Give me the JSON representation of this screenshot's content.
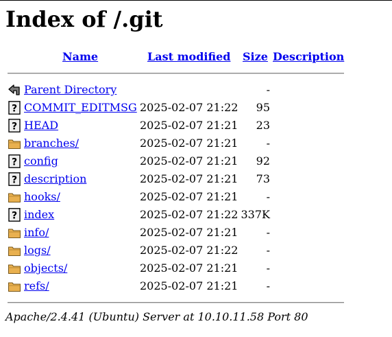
{
  "page": {
    "title": "Index of /.git"
  },
  "table": {
    "headers": {
      "name": "Name",
      "last_modified": "Last modified",
      "size": "Size",
      "description": "Description"
    },
    "rows": [
      {
        "icon": "back-icon",
        "name": "Parent Directory",
        "modified": "",
        "size": "-"
      },
      {
        "icon": "unknown-file-icon",
        "name": "COMMIT_EDITMSG",
        "modified": "2025-02-07 21:22",
        "size": "95"
      },
      {
        "icon": "unknown-file-icon",
        "name": "HEAD",
        "modified": "2025-02-07 21:21",
        "size": "23"
      },
      {
        "icon": "folder-icon",
        "name": "branches/",
        "modified": "2025-02-07 21:21",
        "size": "-"
      },
      {
        "icon": "unknown-file-icon",
        "name": "config",
        "modified": "2025-02-07 21:21",
        "size": "92"
      },
      {
        "icon": "unknown-file-icon",
        "name": "description",
        "modified": "2025-02-07 21:21",
        "size": "73"
      },
      {
        "icon": "folder-icon",
        "name": "hooks/",
        "modified": "2025-02-07 21:21",
        "size": "-"
      },
      {
        "icon": "unknown-file-icon",
        "name": "index",
        "modified": "2025-02-07 21:22",
        "size": "337K"
      },
      {
        "icon": "folder-icon",
        "name": "info/",
        "modified": "2025-02-07 21:21",
        "size": "-"
      },
      {
        "icon": "folder-icon",
        "name": "logs/",
        "modified": "2025-02-07 21:22",
        "size": "-"
      },
      {
        "icon": "folder-icon",
        "name": "objects/",
        "modified": "2025-02-07 21:21",
        "size": "-"
      },
      {
        "icon": "folder-icon",
        "name": "refs/",
        "modified": "2025-02-07 21:21",
        "size": "-"
      }
    ]
  },
  "footer": {
    "text": "Apache/2.4.41 (Ubuntu) Server at 10.10.11.58 Port 80"
  },
  "colors": {
    "link": "#0000ee",
    "folder": "#e9b04f",
    "rule": "#8a8a8a"
  }
}
